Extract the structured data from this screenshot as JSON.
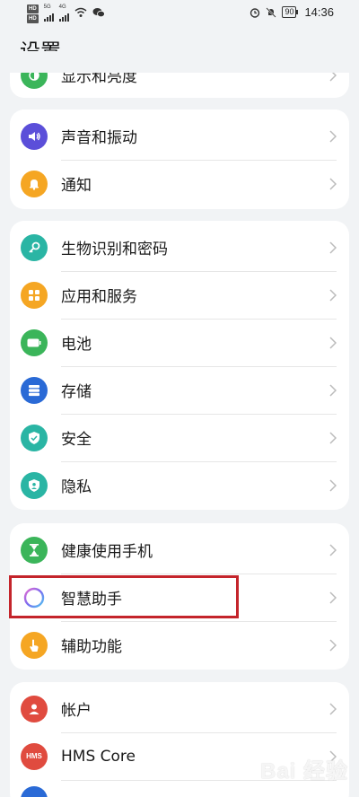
{
  "status_bar": {
    "hd1": "HD",
    "hd2": "HD",
    "net1": "5G",
    "net2": "4G",
    "battery": "90",
    "time": "14:36"
  },
  "page": {
    "title": "设置"
  },
  "card0": {
    "items": [
      {
        "label": "显示和亮度",
        "icon": "display-icon",
        "color": "#3bb55a"
      }
    ]
  },
  "card1": {
    "items": [
      {
        "label": "声音和振动",
        "icon": "sound-icon",
        "color": "#5b4fd9"
      },
      {
        "label": "通知",
        "icon": "bell-icon",
        "color": "#f5a623"
      }
    ]
  },
  "card2": {
    "items": [
      {
        "label": "生物识别和密码",
        "icon": "key-icon",
        "color": "#2ab5a4"
      },
      {
        "label": "应用和服务",
        "icon": "apps-icon",
        "color": "#f5a623"
      },
      {
        "label": "电池",
        "icon": "battery-icon",
        "color": "#3bb55a"
      },
      {
        "label": "存储",
        "icon": "storage-icon",
        "color": "#2a6ad6"
      },
      {
        "label": "安全",
        "icon": "shield-icon",
        "color": "#2ab5a4"
      },
      {
        "label": "隐私",
        "icon": "privacy-icon",
        "color": "#2ab5a4"
      }
    ]
  },
  "card3": {
    "items": [
      {
        "label": "健康使用手机",
        "icon": "hourglass-icon",
        "color": "#3bb55a"
      },
      {
        "label": "智慧助手",
        "icon": "assistant-icon",
        "color": "#8c6be8"
      },
      {
        "label": "辅助功能",
        "icon": "hand-icon",
        "color": "#f5a623"
      }
    ]
  },
  "card4": {
    "items": [
      {
        "label": "帐户",
        "icon": "account-icon",
        "color": "#e04b3f"
      },
      {
        "label": "HMS Core",
        "icon": "hms-icon",
        "color": "#e04b3f",
        "badge": "HMS"
      }
    ]
  },
  "watermark": "Bai 经验"
}
